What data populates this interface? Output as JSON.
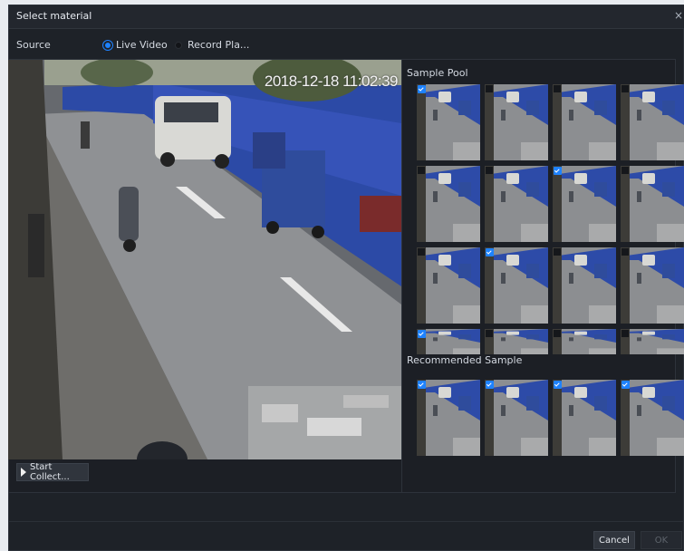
{
  "dialog": {
    "title": "Select material",
    "close_glyph": "×"
  },
  "source": {
    "label": "Source",
    "options": [
      {
        "label": "Live Video",
        "selected": true
      },
      {
        "label": "Record Pla...",
        "selected": false
      }
    ]
  },
  "video": {
    "timestamp": "2018-12-18 11:02:39"
  },
  "start_collect_label": "Start Collect...",
  "sample_pool": {
    "label": "Sample Pool",
    "checked": [
      true,
      false,
      false,
      false,
      false,
      false,
      true,
      false,
      false,
      true,
      false,
      false,
      true,
      false,
      false,
      false
    ]
  },
  "recommended": {
    "label": "Recommended Sample",
    "checked": [
      true,
      true,
      true,
      true
    ]
  },
  "footer": {
    "cancel_label": "Cancel",
    "ok_label": "OK"
  },
  "colors": {
    "accent": "#1e82ff",
    "background": "#1e2228"
  }
}
